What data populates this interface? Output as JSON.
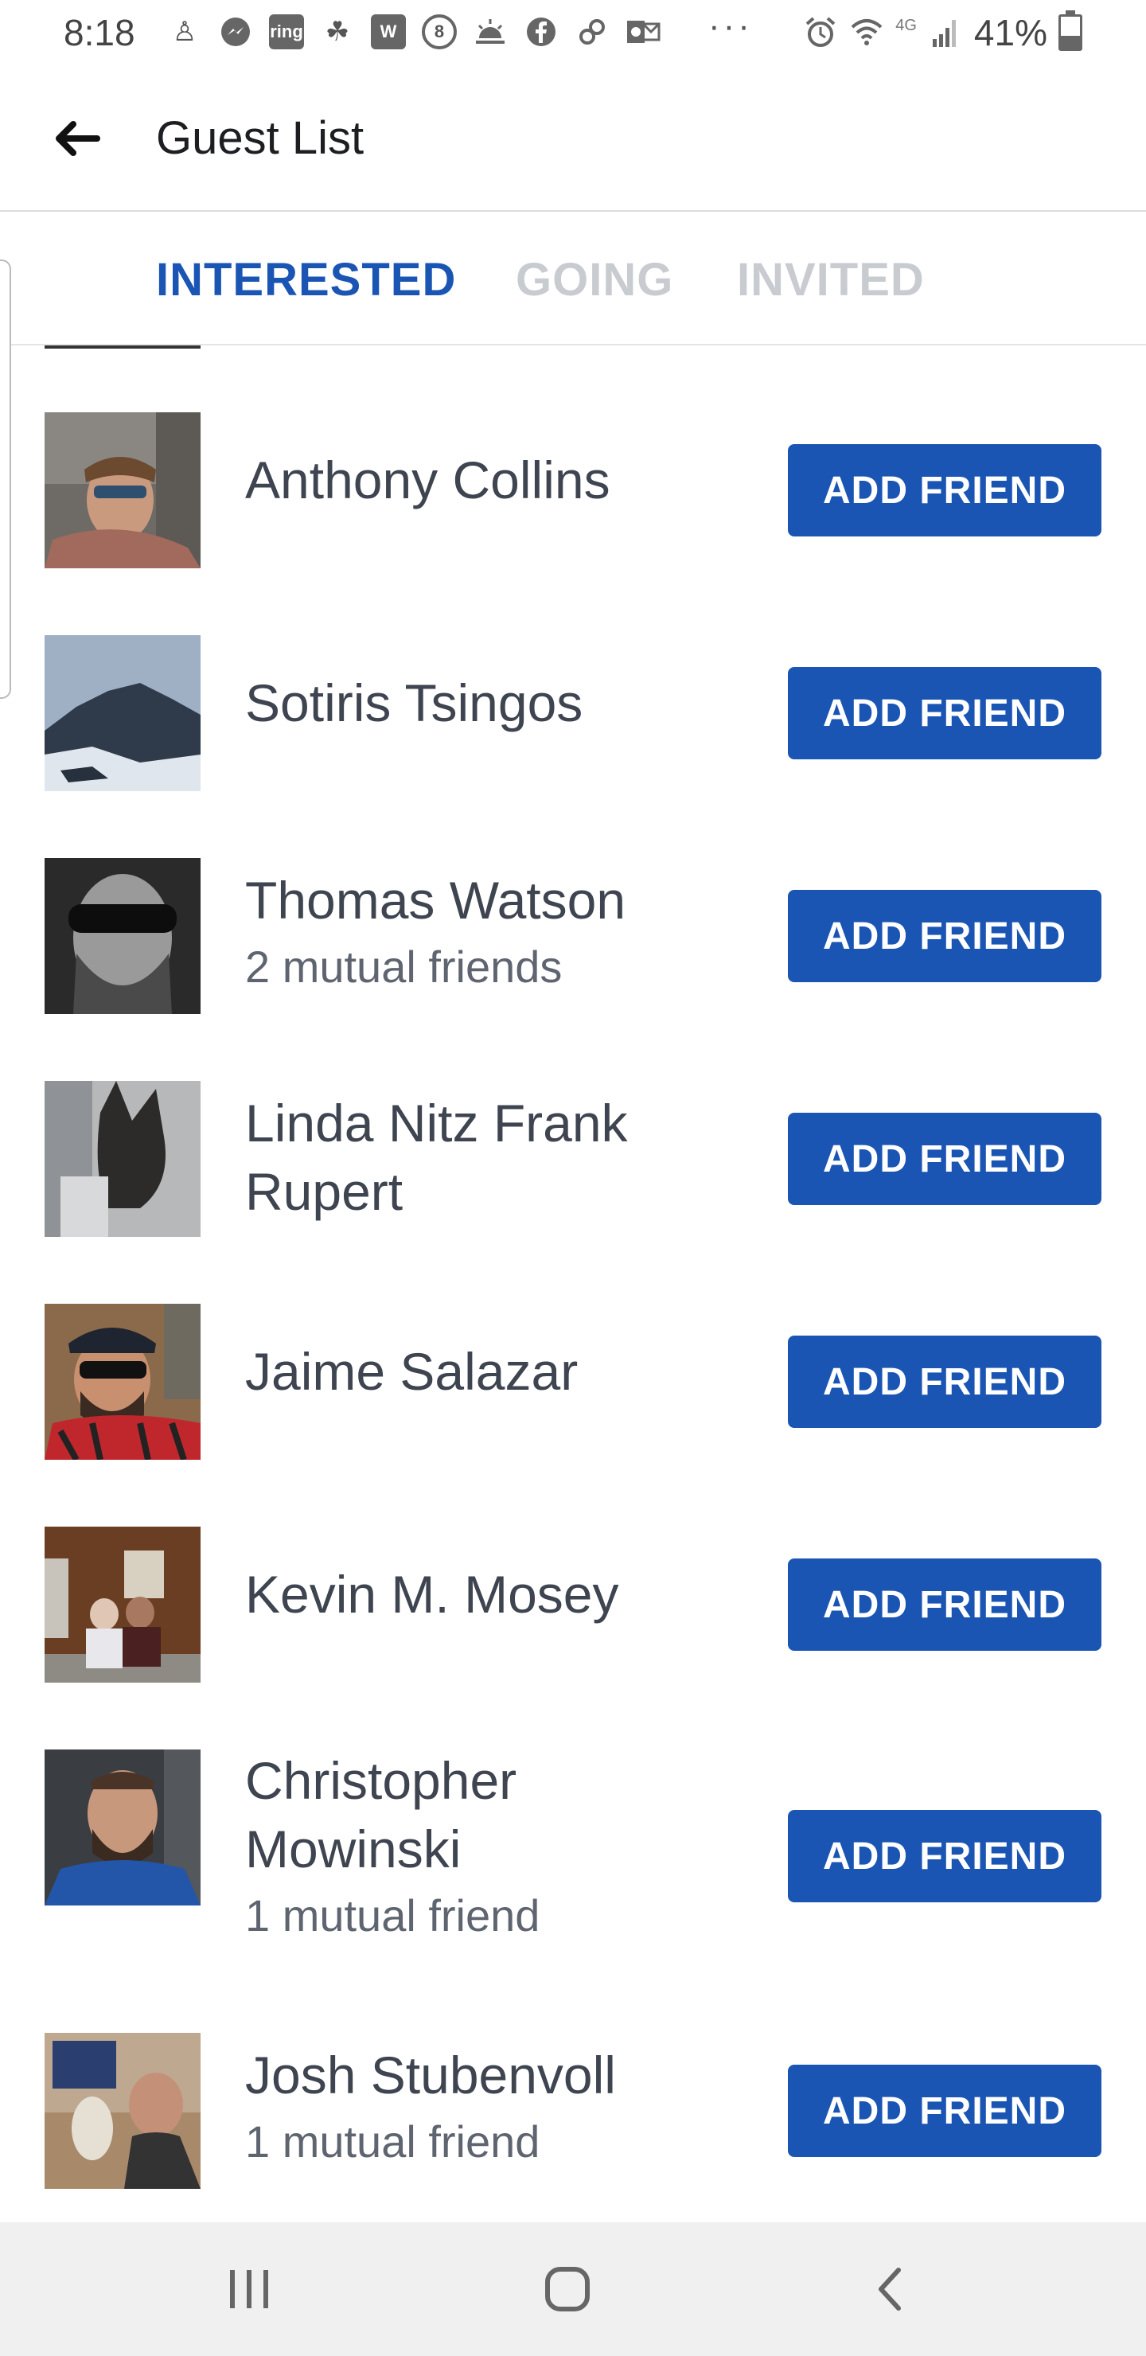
{
  "status": {
    "time": "8:18",
    "battery_pct": "41%",
    "network": "4G",
    "dots": "···",
    "icons": [
      "accessibility-icon",
      "messenger-icon",
      "ring-icon",
      "paw-icon",
      "w-icon",
      "eight-icon",
      "sunrise-icon",
      "facebook-icon",
      "link-icon",
      "outlook-icon"
    ],
    "icon_labels": {
      "ring": "ring",
      "w": "W",
      "eight": "8"
    }
  },
  "header": {
    "title": "Guest List"
  },
  "tabs": [
    {
      "label": "INTERESTED",
      "active": true
    },
    {
      "label": "GOING",
      "active": false
    },
    {
      "label": "INVITED",
      "active": false
    }
  ],
  "guests": [
    {
      "name": "Anthony Collins",
      "mutual": "",
      "button": "ADD FRIEND"
    },
    {
      "name": "Sotiris Tsingos",
      "mutual": "",
      "button": "ADD FRIEND"
    },
    {
      "name": "Thomas Watson",
      "mutual": "2 mutual friends",
      "button": "ADD FRIEND"
    },
    {
      "name": "Linda Nitz Frank Rupert",
      "mutual": "",
      "button": "ADD FRIEND"
    },
    {
      "name": "Jaime Salazar",
      "mutual": "",
      "button": "ADD FRIEND"
    },
    {
      "name": "Kevin M. Mosey",
      "mutual": "",
      "button": "ADD FRIEND"
    },
    {
      "name": "Christopher Mowinski",
      "mutual": "1 mutual friend",
      "button": "ADD FRIEND"
    },
    {
      "name": "Josh Stubenvoll",
      "mutual": "1 mutual friend",
      "button": "ADD FRIEND"
    }
  ],
  "colors": {
    "accent": "#1a55b4",
    "inactive_tab": "#c8cbd0",
    "text": "#3e4450"
  }
}
